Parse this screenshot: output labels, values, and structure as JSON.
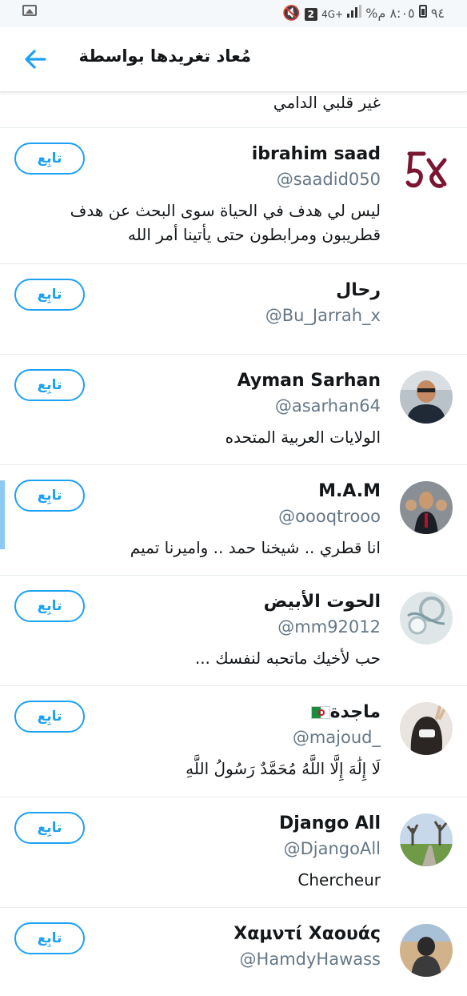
{
  "status_bar": {
    "time": "٨:٠٥ م",
    "battery": "%٩٤",
    "network": "4G+",
    "notification_count": "2"
  },
  "header": {
    "title": "مُعاد تغريدها بواسطة"
  },
  "follow_label": "تابِع",
  "partial_bio": "غير قلبي الدامي",
  "users": [
    {
      "name": "ibrahim saad",
      "handle": "@saadid050",
      "bio": "ليس لي هدف في الحياة سوى البحث عن هدف قطريبون ومرابطون حتى يأتينا أمر الله"
    },
    {
      "name": "رحال",
      "handle": "@Bu_Jarrah_x",
      "bio": ""
    },
    {
      "name": "Ayman Sarhan",
      "handle": "@asarhan64",
      "bio": "الولايات العربية المتحده"
    },
    {
      "name": "M.A.M",
      "handle": "@oooqtrooo",
      "bio": "انا قطري .. شيخنا حمد .. واميرنا تميم"
    },
    {
      "name": "الحوت الأبيض",
      "handle": "@mm92012",
      "bio": "حب لأخيك ماتحبه لنفسك ..."
    },
    {
      "name": "ماجدة",
      "handle": "@majoud_",
      "bio": "لَا إِلَٰهَ إِلَّا اللَّهُ مُحَمَّدٌ رَسُولُ اللَّهِ"
    },
    {
      "name": "Django All",
      "handle": "@DjangoAll",
      "bio": "Chercheur"
    },
    {
      "name": "Χαμντί Χαουάς",
      "handle": "@HamdyHawass",
      "bio": ""
    }
  ],
  "colors": {
    "accent": "#1da1f2",
    "secondary_text": "#657786",
    "divider": "#e6ecf0"
  }
}
